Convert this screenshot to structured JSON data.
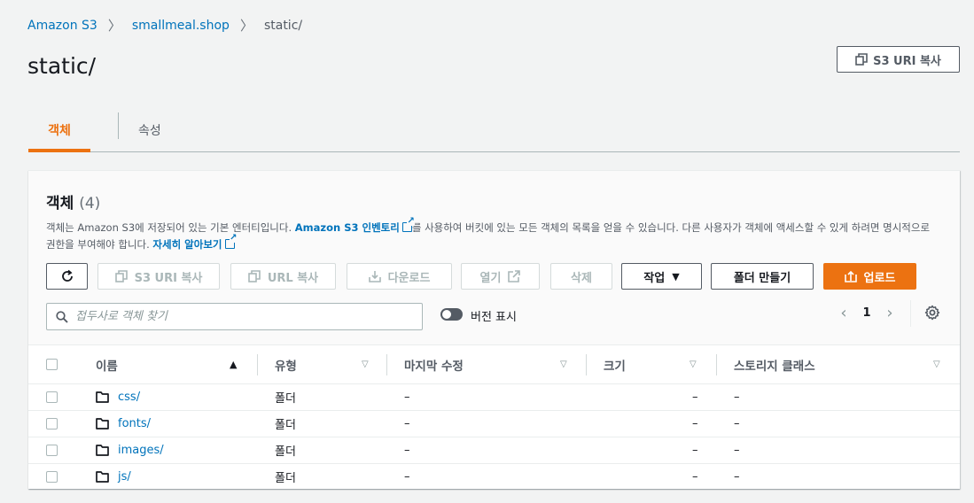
{
  "breadcrumb": {
    "items": [
      "Amazon S3",
      "smallmeal.shop",
      "static/"
    ]
  },
  "page": {
    "title": "static/",
    "copy_uri_label": "S3 URI 복사"
  },
  "tabs": [
    {
      "label": "객체",
      "active": true
    },
    {
      "label": "속성",
      "active": false
    }
  ],
  "objects_panel": {
    "title": "객체",
    "count": "(4)",
    "desc_part1": "객체는 Amazon S3에 저장되어 있는 기본 엔터티입니다.",
    "desc_link1": "Amazon S3 인벤토리",
    "desc_part2": "를 사용하여 버킷에 있는 모든 객체의 목록을 얻을 수 있습니다. 다른 사용자가 객체에 액세스할 수 있게 하려면 명시적으로 권한을 부여해야 합니다.",
    "desc_link2": "자세히 알아보기"
  },
  "toolbar": {
    "copy_s3_uri": "S3 URI 복사",
    "copy_url": "URL 복사",
    "download": "다운로드",
    "open": "열기",
    "delete": "삭제",
    "actions": "작업",
    "create_folder": "폴더 만들기",
    "upload": "업로드"
  },
  "search": {
    "placeholder": "접두사로 객체 찾기"
  },
  "versions_toggle": {
    "label": "버전 표시"
  },
  "pagination": {
    "current_page": "1"
  },
  "table": {
    "columns": [
      "이름",
      "유형",
      "마지막 수정",
      "크기",
      "스토리지 클래스"
    ],
    "rows": [
      {
        "name": "css/",
        "type": "폴더",
        "modified": "–",
        "size": "–",
        "storage": "–"
      },
      {
        "name": "fonts/",
        "type": "폴더",
        "modified": "–",
        "size": "–",
        "storage": "–"
      },
      {
        "name": "images/",
        "type": "폴더",
        "modified": "–",
        "size": "–",
        "storage": "–"
      },
      {
        "name": "js/",
        "type": "폴더",
        "modified": "–",
        "size": "–",
        "storage": "–"
      }
    ]
  },
  "colors": {
    "accent": "#ec7211",
    "link": "#0073bb"
  }
}
